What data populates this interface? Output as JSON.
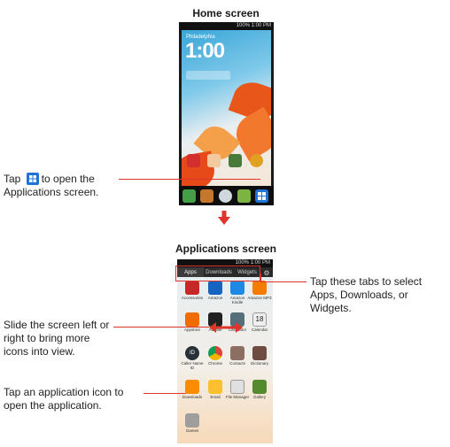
{
  "home": {
    "heading": "Home screen",
    "status_text": "100% 1:00 PM",
    "clock_city": "Philadelphia",
    "clock_time": "1:00",
    "callout": {
      "prefix": "Tap",
      "suffix": "to open the",
      "line2": "Applications screen."
    }
  },
  "apps_screen": {
    "heading": "Applications screen",
    "status_text": "100% 1:00 PM",
    "tabs": [
      "Apps",
      "Downloads",
      "Widgets"
    ],
    "apps": [
      {
        "label": "Accessories",
        "color": "#c62828"
      },
      {
        "label": "Amazon",
        "color": "#1565c0"
      },
      {
        "label": "Amazon Kindle",
        "color": "#1e88e5"
      },
      {
        "label": "Amazon MP3",
        "color": "#f57c00"
      },
      {
        "label": "Appstore",
        "color": "#ef6c00"
      },
      {
        "label": "Audible",
        "color": "#212121"
      },
      {
        "label": "Calculator",
        "color": "#546e7a"
      },
      {
        "label": "Calendar",
        "color": "#eeeeee"
      },
      {
        "label": "Caller Name ID",
        "color": "#263238"
      },
      {
        "label": "Chrome",
        "color": "#43a047"
      },
      {
        "label": "Contacts",
        "color": "#8d6e63"
      },
      {
        "label": "Dictionary",
        "color": "#6d4c41"
      },
      {
        "label": "Downloads",
        "color": "#fb8c00"
      },
      {
        "label": "Email",
        "color": "#fbc02d"
      },
      {
        "label": "File Manager",
        "color": "#e0e0e0"
      },
      {
        "label": "Gallery",
        "color": "#558b2f"
      },
      {
        "label": "Games",
        "color": "#9e9e9e"
      }
    ],
    "callouts": {
      "tabs": "Tap these tabs to select Apps, Downloads, or Widgets.",
      "slide": "Slide the screen left or right to bring more icons into view.",
      "tap": "Tap an application icon to open the application."
    }
  },
  "colors": {
    "accent_red": "#e0342a",
    "apps_grid_icon": "#1e73d9"
  }
}
